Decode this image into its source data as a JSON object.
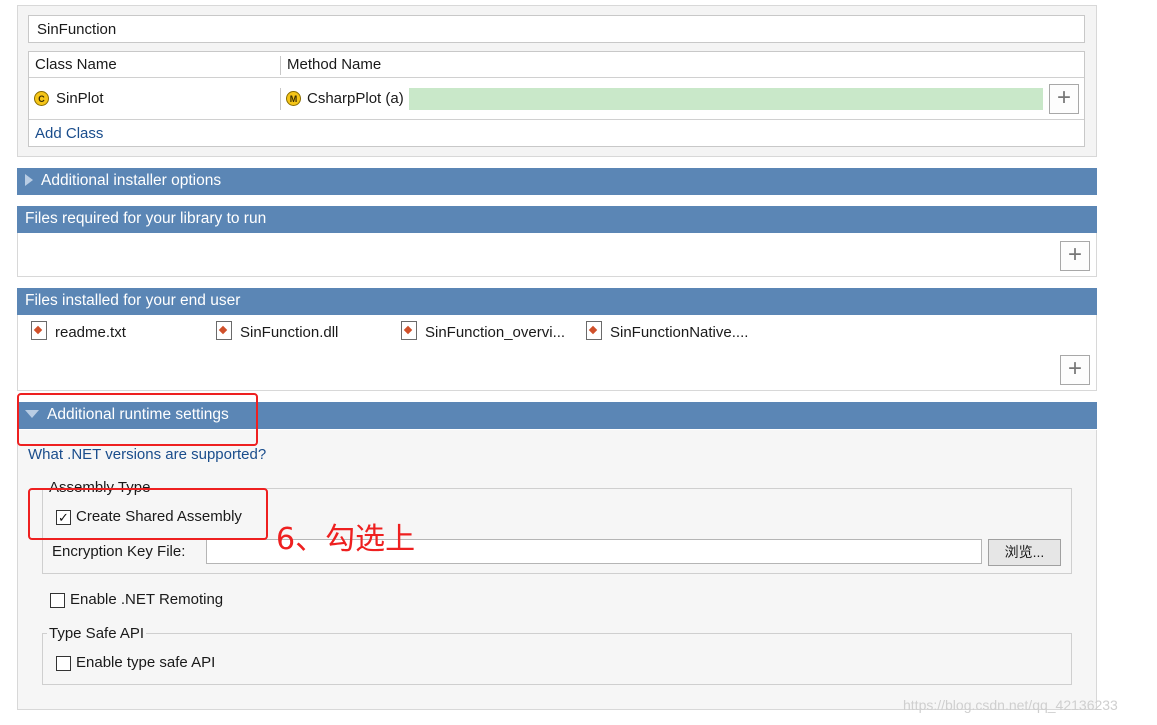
{
  "top": {
    "function_name": "SinFunction",
    "table": {
      "col_class": "Class Name",
      "col_method": "Method Name",
      "class_badge": "C",
      "class_value": "SinPlot",
      "method_badge": "M",
      "method_value": "CsharpPlot (a)",
      "add_class": "Add Class"
    }
  },
  "sections": {
    "installer": "Additional installer options",
    "required": "Files required for your library to run",
    "installed": "Files installed for your end user",
    "runtime": "Additional runtime settings"
  },
  "installed_files": [
    "readme.txt",
    "SinFunction.dll",
    "SinFunction_overvi...",
    "SinFunctionNative...."
  ],
  "runtime": {
    "net_link": "What .NET versions are supported?",
    "assembly_group": "Assembly Type",
    "shared_assembly_label": "Create Shared Assembly",
    "shared_assembly_checked": true,
    "shared_assembly_check": "✓",
    "encryption_label": "Encryption Key File:",
    "encryption_value": "",
    "browse_label": "浏览...",
    "remoting_label": "Enable .NET Remoting",
    "remoting_checked": false,
    "typesafe_group": "Type Safe API",
    "typesafe_label": "Enable type safe API",
    "typesafe_checked": false
  },
  "annotation_text": "6、勾选上",
  "watermark": "https://blog.csdn.net/qq_42136233",
  "icons": {
    "plus": "+",
    "expand_collapsed": "triangle-right-icon",
    "expand_open": "triangle-down-icon",
    "file": "document-icon"
  },
  "colors": {
    "section_header": "#5b86b5",
    "link": "#1a4d8c",
    "annotation_red": "#ee2020",
    "method_bar_green": "#c9e8c9"
  }
}
